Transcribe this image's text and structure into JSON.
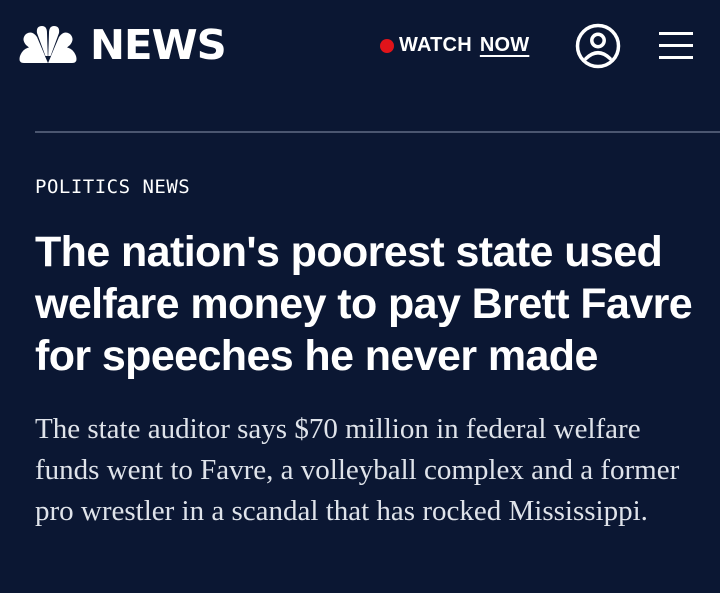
{
  "header": {
    "logo_text": "NEWS",
    "watch_label": "WATCH",
    "now_label": "NOW",
    "icons": {
      "logo": "peacock-icon",
      "live": "live-dot-icon",
      "account": "account-icon",
      "menu": "hamburger-menu-icon"
    }
  },
  "article": {
    "eyebrow": "POLITICS NEWS",
    "headline": "The nation's poorest state used welfare money to pay Brett Favre for speeches he never made",
    "dek": "The state auditor says $70 million in federal welfare funds went to Favre, a volleyball complex and a former pro wrestler in a scandal that has rocked Mississippi."
  },
  "colors": {
    "background": "#0b1733",
    "text": "#ffffff",
    "live_dot": "#e1141a",
    "divider": "#4b5670"
  }
}
